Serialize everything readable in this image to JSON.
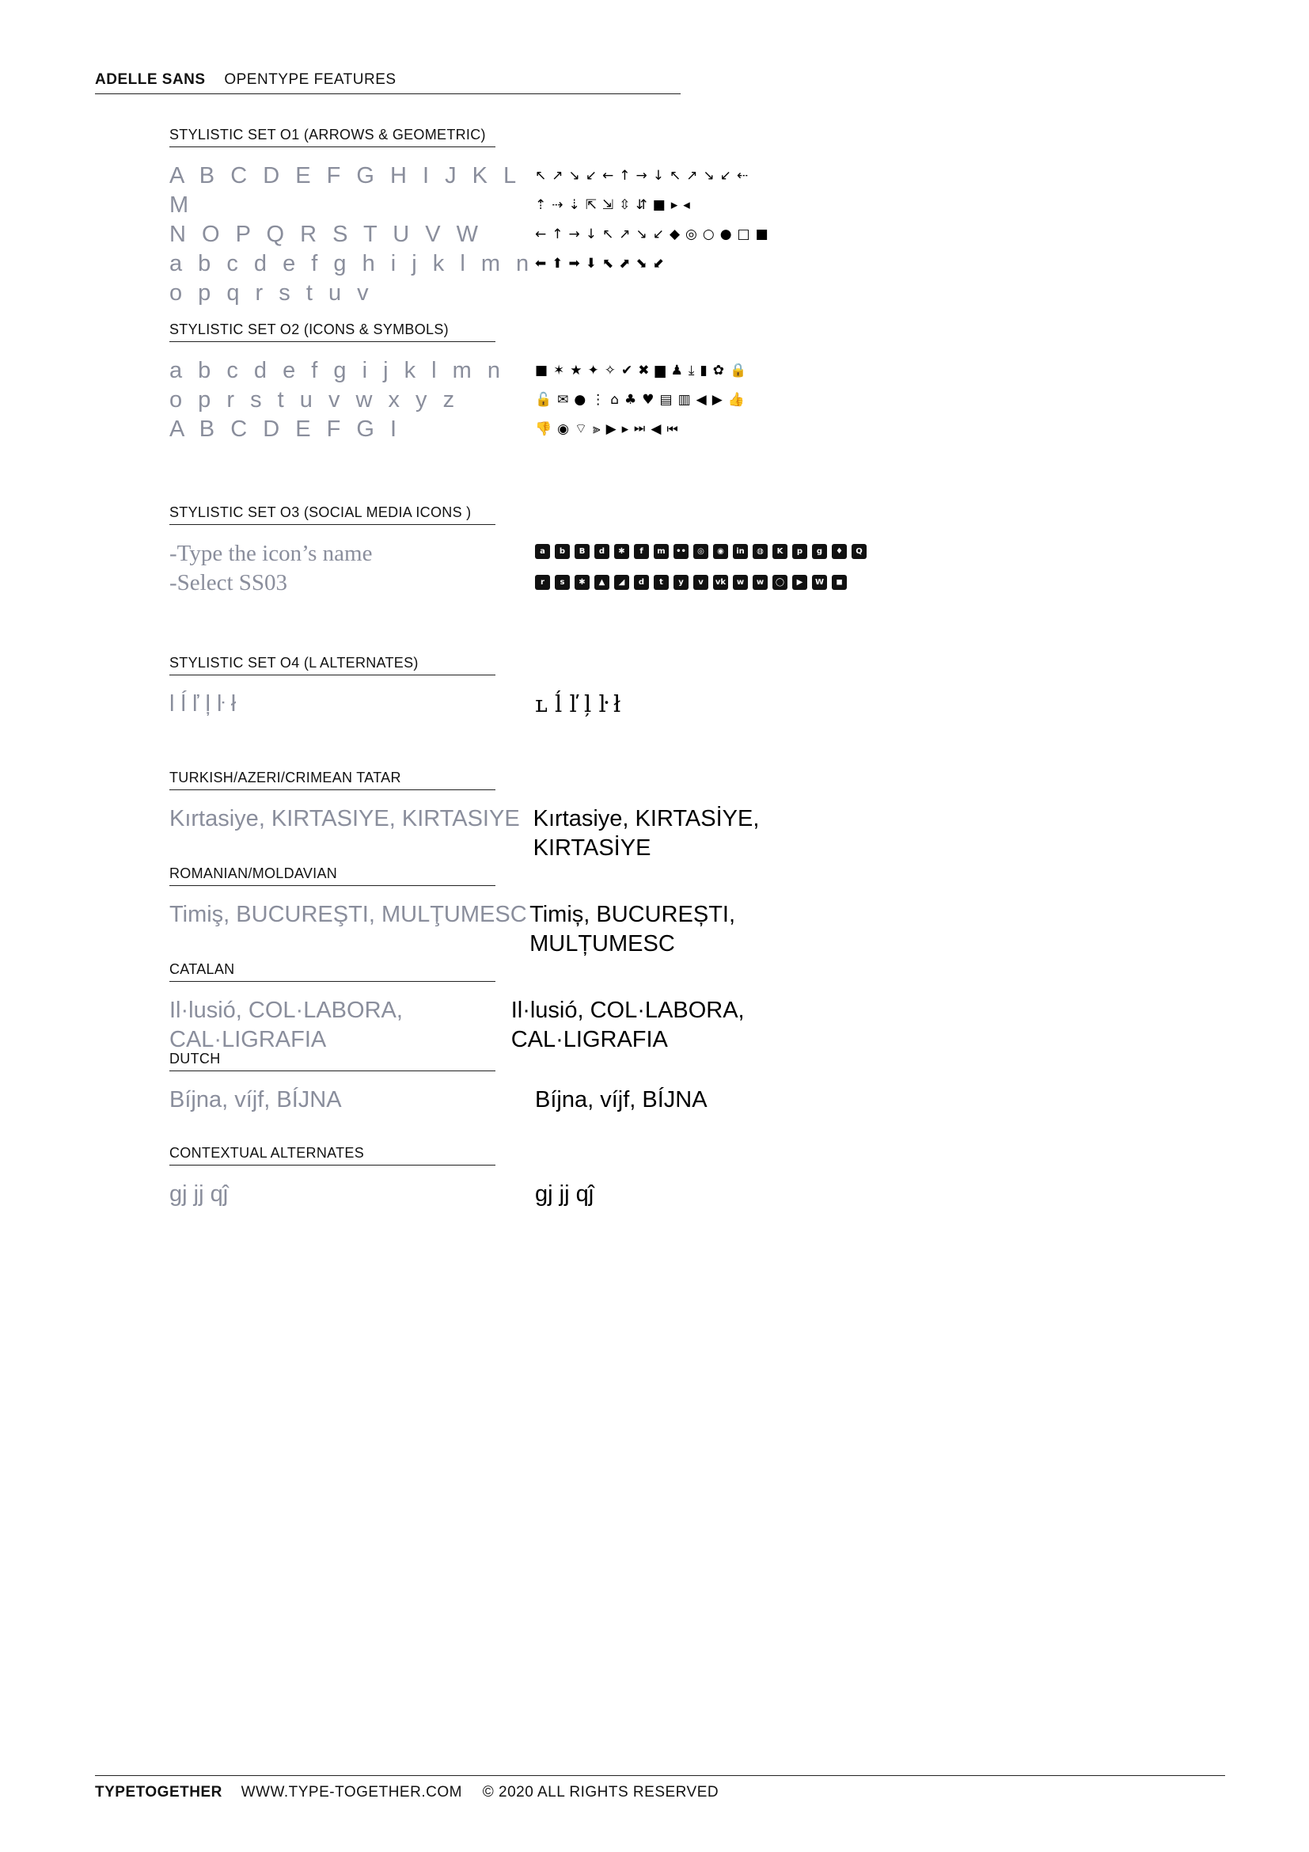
{
  "header": {
    "brand": "ADELLE SANS",
    "title": "OPENTYPE FEATURES"
  },
  "sections": [
    {
      "label": "STYLISTIC SET O1 (ARROWS & GEOMETRIC)",
      "left": [
        "A B C D E F G H I J K L M",
        "N O P Q R S T U V W",
        "a b c d e f g h i j k l m n",
        "o p q r s t u v"
      ],
      "right": [
        "↖↗↘↙←↑→↓↖↗↘↙⇠",
        "⇡⇢⇣⇱⇲⇳⇵■▸◂",
        "←↑→↓↖↗↘↙◆◎○●□■",
        "⬅⬆➡⬇⬉⬈⬊⬋"
      ]
    },
    {
      "label": "STYLISTIC SET O2 (ICONS & SYMBOLS)",
      "left": [
        "a b c d e f g i j k l m n",
        "o p r s t u v w x y z",
        "A B C D E F G I"
      ],
      "right": [
        "■✶★✦✧✔✖▆♟⤓▮✿🔒",
        "🔓✉●⋮⌂♣♥▤▥◀▶👍",
        "👎◉⌔⫸▶▸⏭◀⏮"
      ]
    },
    {
      "label": "STYLISTIC SET O3 (SOCIAL MEDIA ICONS )",
      "left": [
        "-Type the icon’s name",
        "-Select SS03"
      ],
      "icons": [
        "a",
        "b",
        "B",
        "d",
        "✱",
        "f",
        "m",
        "••",
        "◎",
        "◉",
        "in",
        "◍",
        "K",
        "p",
        "g",
        "♦",
        "Q",
        "r",
        "s",
        "✱",
        "▲",
        "◢",
        "d",
        "t",
        "y",
        "v",
        "vk",
        "w",
        "weibo",
        "◯",
        "▶",
        "W",
        "◼"
      ]
    },
    {
      "label": "STYLISTIC SET O4 (L ALTERNATES)",
      "left": "l ĺ ľ ļ ŀ ł",
      "right": "ʟ ĺ ľ ļ ŀ ł"
    },
    {
      "label": "TURKISH/AZERI/CRIMEAN TATAR",
      "left": "Kırtasiye, KIRTASIYE, KIRTASIYE",
      "right": "Kırtasiye, KIRTASİYE, KIRTASİYE"
    },
    {
      "label": "ROMANIAN/MOLDAVIAN",
      "left": "Timiş, BUCUREŞTI, MULŢUMESC",
      "right": "Timiș, BUCUREȘTI, MULȚUMESC"
    },
    {
      "label": "CATALAN",
      "left": "Il·lusió, COL·LABORA, CAL·LIGRAFIA",
      "right": "Il·lusió, COL·LABORA, CAL·LIGRAFIA"
    },
    {
      "label": "DUTCH",
      "left": "Bíjna, víjf, BÍJNA",
      "right": "Bíjna, víjf, BÍJNA"
    },
    {
      "label": "CONTEXTUAL ALTERNATES",
      "left": "gj jj qĵ",
      "right": "gj jj qĵ"
    }
  ],
  "footer": {
    "brand": "TYPETOGETHER",
    "url": "WWW.TYPE-TOGETHER.COM",
    "copyright": "© 2020 ALL RIGHTS RESERVED"
  }
}
